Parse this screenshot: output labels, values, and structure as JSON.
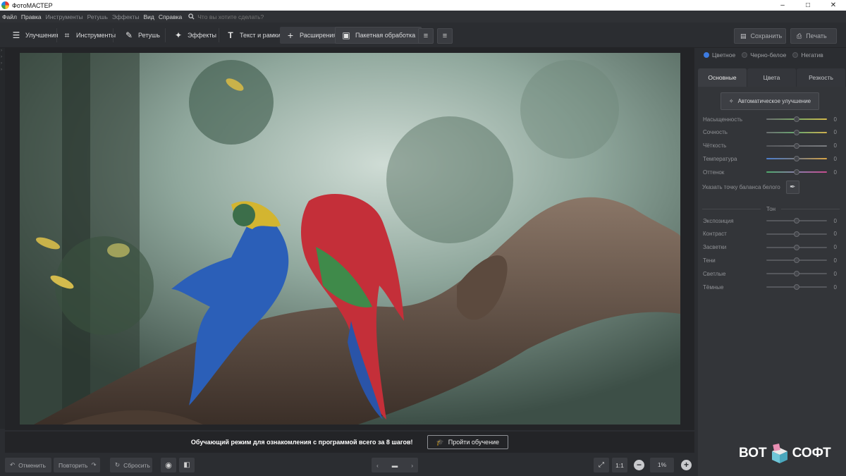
{
  "window": {
    "title": "ФотоМАСТЕР",
    "controls": [
      "–",
      "□",
      "✕"
    ]
  },
  "menu": {
    "items": [
      "Файл",
      "Правка",
      "Инструменты",
      "Ретушь",
      "Эффекты",
      "Вид",
      "Справка"
    ],
    "search_placeholder": "Что вы хотите сделать?"
  },
  "toolbar": {
    "tools": [
      {
        "label": "Улучшения",
        "icon": "sliders-icon"
      },
      {
        "label": "Инструменты",
        "icon": "crop-icon"
      },
      {
        "label": "Ретушь",
        "icon": "brush-icon"
      },
      {
        "label": "Эффекты",
        "icon": "sparkle-icon"
      },
      {
        "label": "Текст и рамки",
        "icon": "text-icon"
      },
      {
        "label": "Расширения",
        "icon": "plus-icon"
      }
    ],
    "batch_label": "Пакетная обработка",
    "save_label": "Сохранить",
    "print_label": "Печать"
  },
  "tutorial": {
    "message": "Обучающий режим для ознакомления с программой всего за 8 шагов!",
    "button": "Пройти обучение"
  },
  "bottom": {
    "undo": "Отменить",
    "redo": "Повторить",
    "reset": "Сбросить",
    "ratio": "1:1",
    "zoom": "1%"
  },
  "panel": {
    "modes": [
      {
        "label": "Цветное",
        "selected": true
      },
      {
        "label": "Черно-белое",
        "selected": false
      },
      {
        "label": "Негатив",
        "selected": false
      }
    ],
    "tabs": [
      "Основные",
      "Цвета",
      "Резкость"
    ],
    "active_tab": "Основные",
    "auto_button": "Автоматическое улучшение",
    "color_sliders": [
      {
        "label": "Насыщенность",
        "value": "0",
        "level": 0.5
      },
      {
        "label": "Сочность",
        "value": "0",
        "level": 0.5
      },
      {
        "label": "Чёткость",
        "value": "0",
        "level": 0.5
      },
      {
        "label": "Температура",
        "value": "0",
        "level": 0.5
      },
      {
        "label": "Оттенок",
        "value": "0",
        "level": 0.5
      }
    ],
    "white_balance": "Указать точку баланса белого",
    "tone_section": "Тон",
    "tone_sliders": [
      {
        "label": "Экспозиция",
        "value": "0",
        "level": 0.5
      },
      {
        "label": "Контраст",
        "value": "0",
        "level": 0.5
      },
      {
        "label": "Засветки",
        "value": "0",
        "level": 0.5
      },
      {
        "label": "Тени",
        "value": "0",
        "level": 0.5
      },
      {
        "label": "Светлые",
        "value": "0",
        "level": 0.5
      },
      {
        "label": "Тёмные",
        "value": "0",
        "level": 0.5
      }
    ]
  },
  "watermark": {
    "left": "ВОТ",
    "right": "СОФТ"
  },
  "colors": {
    "accent": "#3d7be0",
    "background": "#2b2d31",
    "panel": "#333539"
  }
}
